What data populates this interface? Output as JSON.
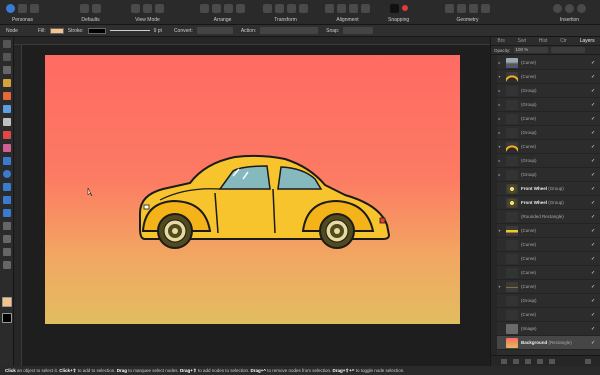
{
  "toolbar": {
    "groups": [
      {
        "label": "Personas"
      },
      {
        "label": "Defaults"
      },
      {
        "label": "View Mode"
      },
      {
        "label": "Arrange"
      },
      {
        "label": "Transform"
      },
      {
        "label": "Alignment"
      },
      {
        "label": "Snapping"
      },
      {
        "label": "Geometry"
      },
      {
        "label": "Insertion"
      }
    ]
  },
  "context": {
    "tool": "Node",
    "fill_label": "Fill:",
    "fill_color": "#f6c48a",
    "stroke_label": "Stroke:",
    "stroke_width": "9 pt",
    "convert_label": "Convert:",
    "action_label": "Action:",
    "snap_label": "Snap:"
  },
  "panel": {
    "tabs": [
      "Brs",
      "Swt",
      "Hist",
      "Ctr",
      "Layers"
    ],
    "active_tab": "Layers",
    "opacity_label": "Opacity:",
    "opacity_value": "100 %",
    "layers": [
      {
        "name": "(Curve)",
        "thumb": "car-grey",
        "expanded": false
      },
      {
        "name": "(Curve)",
        "thumb": "arc-yellow",
        "expanded": true
      },
      {
        "name": "(Group)",
        "thumb": "dark",
        "expanded": false
      },
      {
        "name": "(Group)",
        "thumb": "dark",
        "expanded": false
      },
      {
        "name": "(Curve)",
        "thumb": "dark",
        "expanded": false
      },
      {
        "name": "(Group)",
        "thumb": "dark",
        "expanded": false
      },
      {
        "name": "(Curve)",
        "thumb": "arc-yellow",
        "expanded": true
      },
      {
        "name": "(Group)",
        "thumb": "dark",
        "expanded": false
      },
      {
        "name": "(Group)",
        "thumb": "dark",
        "expanded": false
      },
      {
        "name": "Front Wheel",
        "suffix": "(Group)",
        "thumb": "wheel",
        "bold": true
      },
      {
        "name": "Front Wheel",
        "suffix": "(Group)",
        "thumb": "wheel",
        "bold": true
      },
      {
        "name": "(Rounded Rectangle)",
        "thumb": "dark"
      },
      {
        "name": "(Curve)",
        "thumb": "car-yellow",
        "expanded": true
      },
      {
        "name": "(Curve)",
        "thumb": "dark"
      },
      {
        "name": "(Curve)",
        "thumb": "dark"
      },
      {
        "name": "(Curve)",
        "thumb": "dark"
      },
      {
        "name": "(Curve)",
        "thumb": "line",
        "expanded": true
      },
      {
        "name": "(Group)",
        "thumb": "dark"
      },
      {
        "name": "(Curve)",
        "thumb": "dark"
      },
      {
        "name": "(Image)",
        "thumb": "image"
      },
      {
        "name": "Background",
        "suffix": "(Rectangle)",
        "thumb": "bg",
        "bold": true,
        "selected": true
      }
    ]
  },
  "status": {
    "text_parts": [
      {
        "t": "Click",
        "b": true
      },
      {
        "t": " an object to select it. ",
        "b": false
      },
      {
        "t": "Click+⇧",
        "b": true
      },
      {
        "t": " to add to selection. ",
        "b": false
      },
      {
        "t": "Drag",
        "b": true
      },
      {
        "t": " to marquee select nodes. ",
        "b": false
      },
      {
        "t": "Drag+⇧",
        "b": true
      },
      {
        "t": " to add nodes to selection. ",
        "b": false
      },
      {
        "t": "Drag+^",
        "b": true
      },
      {
        "t": " to remove nodes from selection. ",
        "b": false
      },
      {
        "t": "Drag+⇧+^",
        "b": true
      },
      {
        "t": " to toggle node selection.",
        "b": false
      }
    ]
  }
}
